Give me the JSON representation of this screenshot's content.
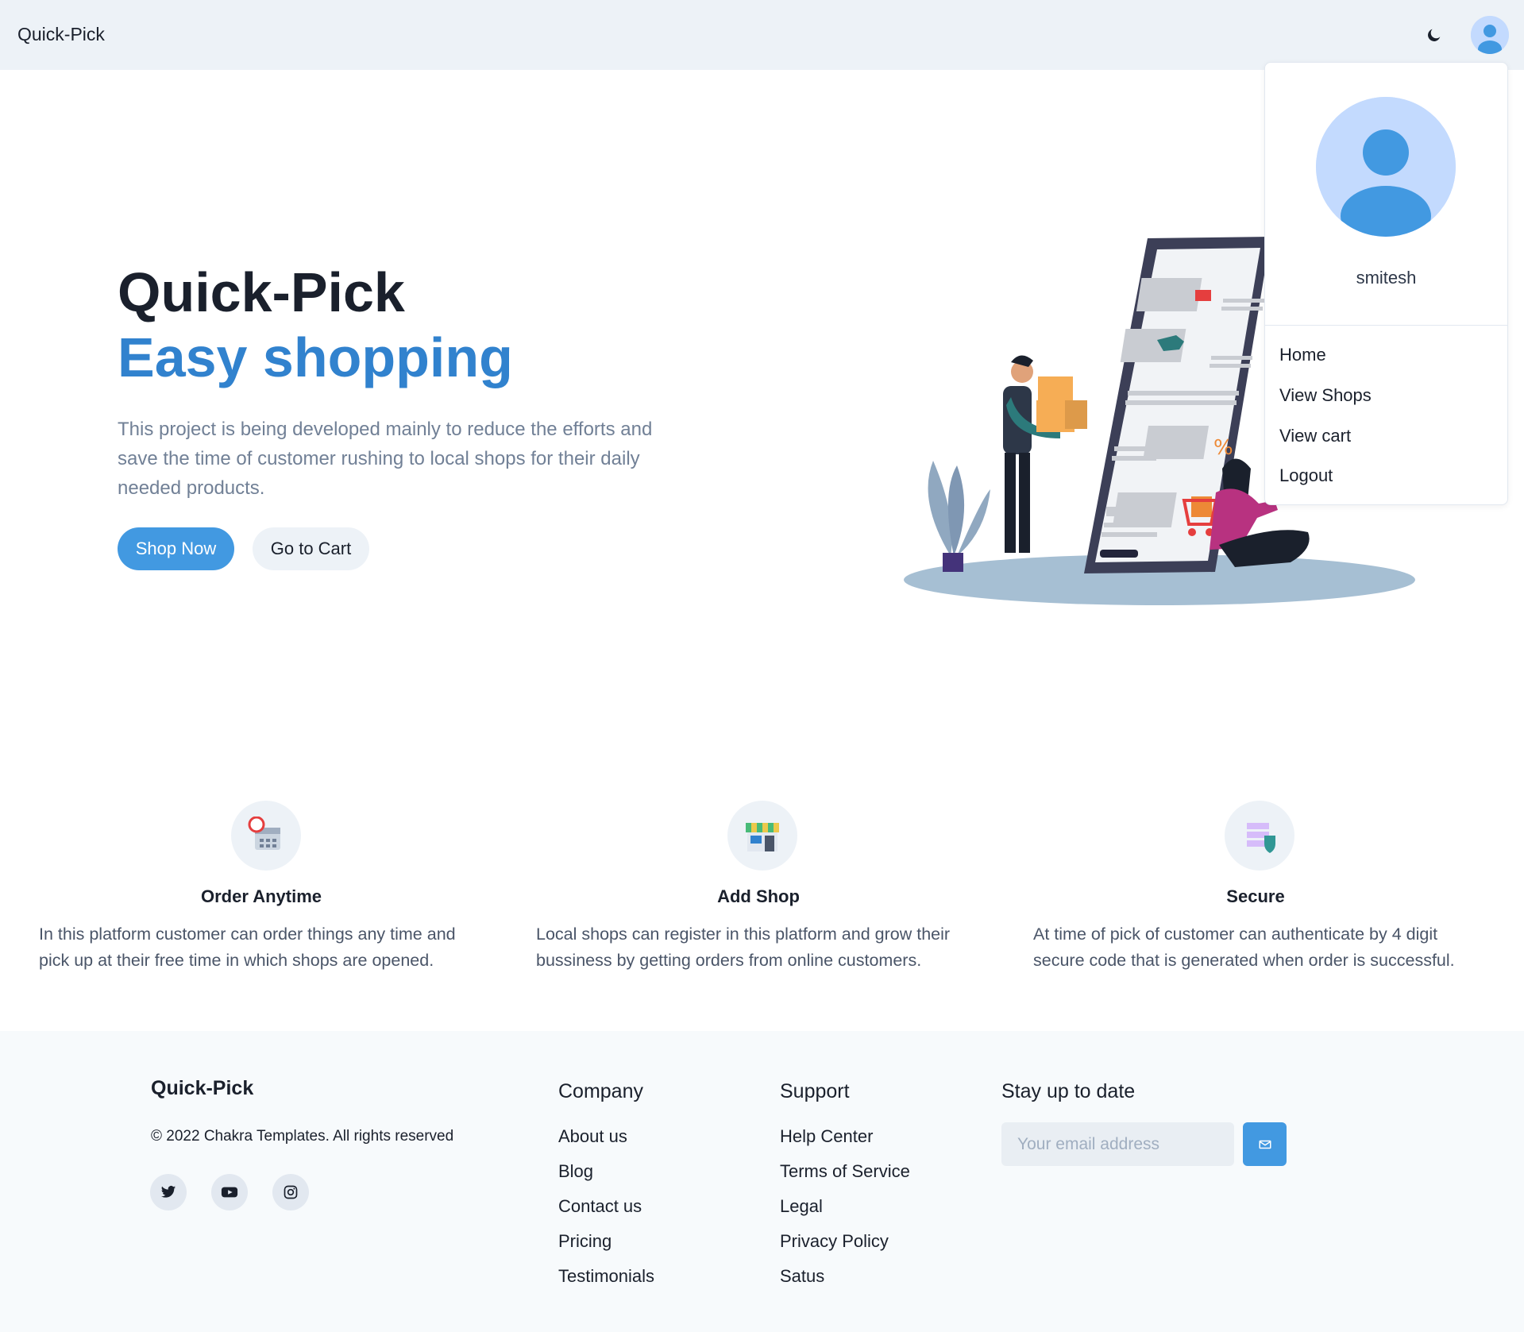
{
  "navbar": {
    "brand": "Quick-Pick",
    "theme_toggle_icon": "moon-icon",
    "avatar_icon": "user-avatar-icon"
  },
  "user_menu": {
    "username": "smitesh",
    "items": [
      {
        "label": "Home"
      },
      {
        "label": "View Shops"
      },
      {
        "label": "View cart"
      },
      {
        "label": "Logout"
      }
    ]
  },
  "hero": {
    "title": "Quick-Pick",
    "subtitle": "Easy shopping",
    "description": "This project is being developed mainly to reduce the efforts and save the time of customer rushing to local shops for their daily needed products.",
    "primary_button": "Shop Now",
    "secondary_button": "Go to Cart"
  },
  "features": [
    {
      "icon": "calendar-icon",
      "title": "Order Anytime",
      "description": "In this platform customer can order things any time and pick up at their free time in which shops are opened."
    },
    {
      "icon": "shop-icon",
      "title": "Add Shop",
      "description": "Local shops can register in this platform and grow their bussiness by getting orders from online customers."
    },
    {
      "icon": "secure-shield-icon",
      "title": "Secure",
      "description": "At time of pick of customer can authenticate by 4 digit secure code that is generated when order is successful."
    }
  ],
  "footer": {
    "brand": "Quick-Pick",
    "copyright": "© 2022 Chakra Templates. All rights reserved",
    "social": [
      "twitter-icon",
      "youtube-icon",
      "instagram-icon"
    ],
    "company": {
      "heading": "Company",
      "links": [
        "About us",
        "Blog",
        "Contact us",
        "Pricing",
        "Testimonials"
      ]
    },
    "support": {
      "heading": "Support",
      "links": [
        "Help Center",
        "Terms of Service",
        "Legal",
        "Privacy Policy",
        "Satus"
      ]
    },
    "newsletter": {
      "heading": "Stay up to date",
      "placeholder": "Your email address",
      "button_icon": "send-mail-icon"
    }
  },
  "colors": {
    "accent": "#4299e1",
    "accent_dark": "#3182ce",
    "nav_bg": "#edf2f7",
    "footer_bg": "#f7fafc"
  }
}
